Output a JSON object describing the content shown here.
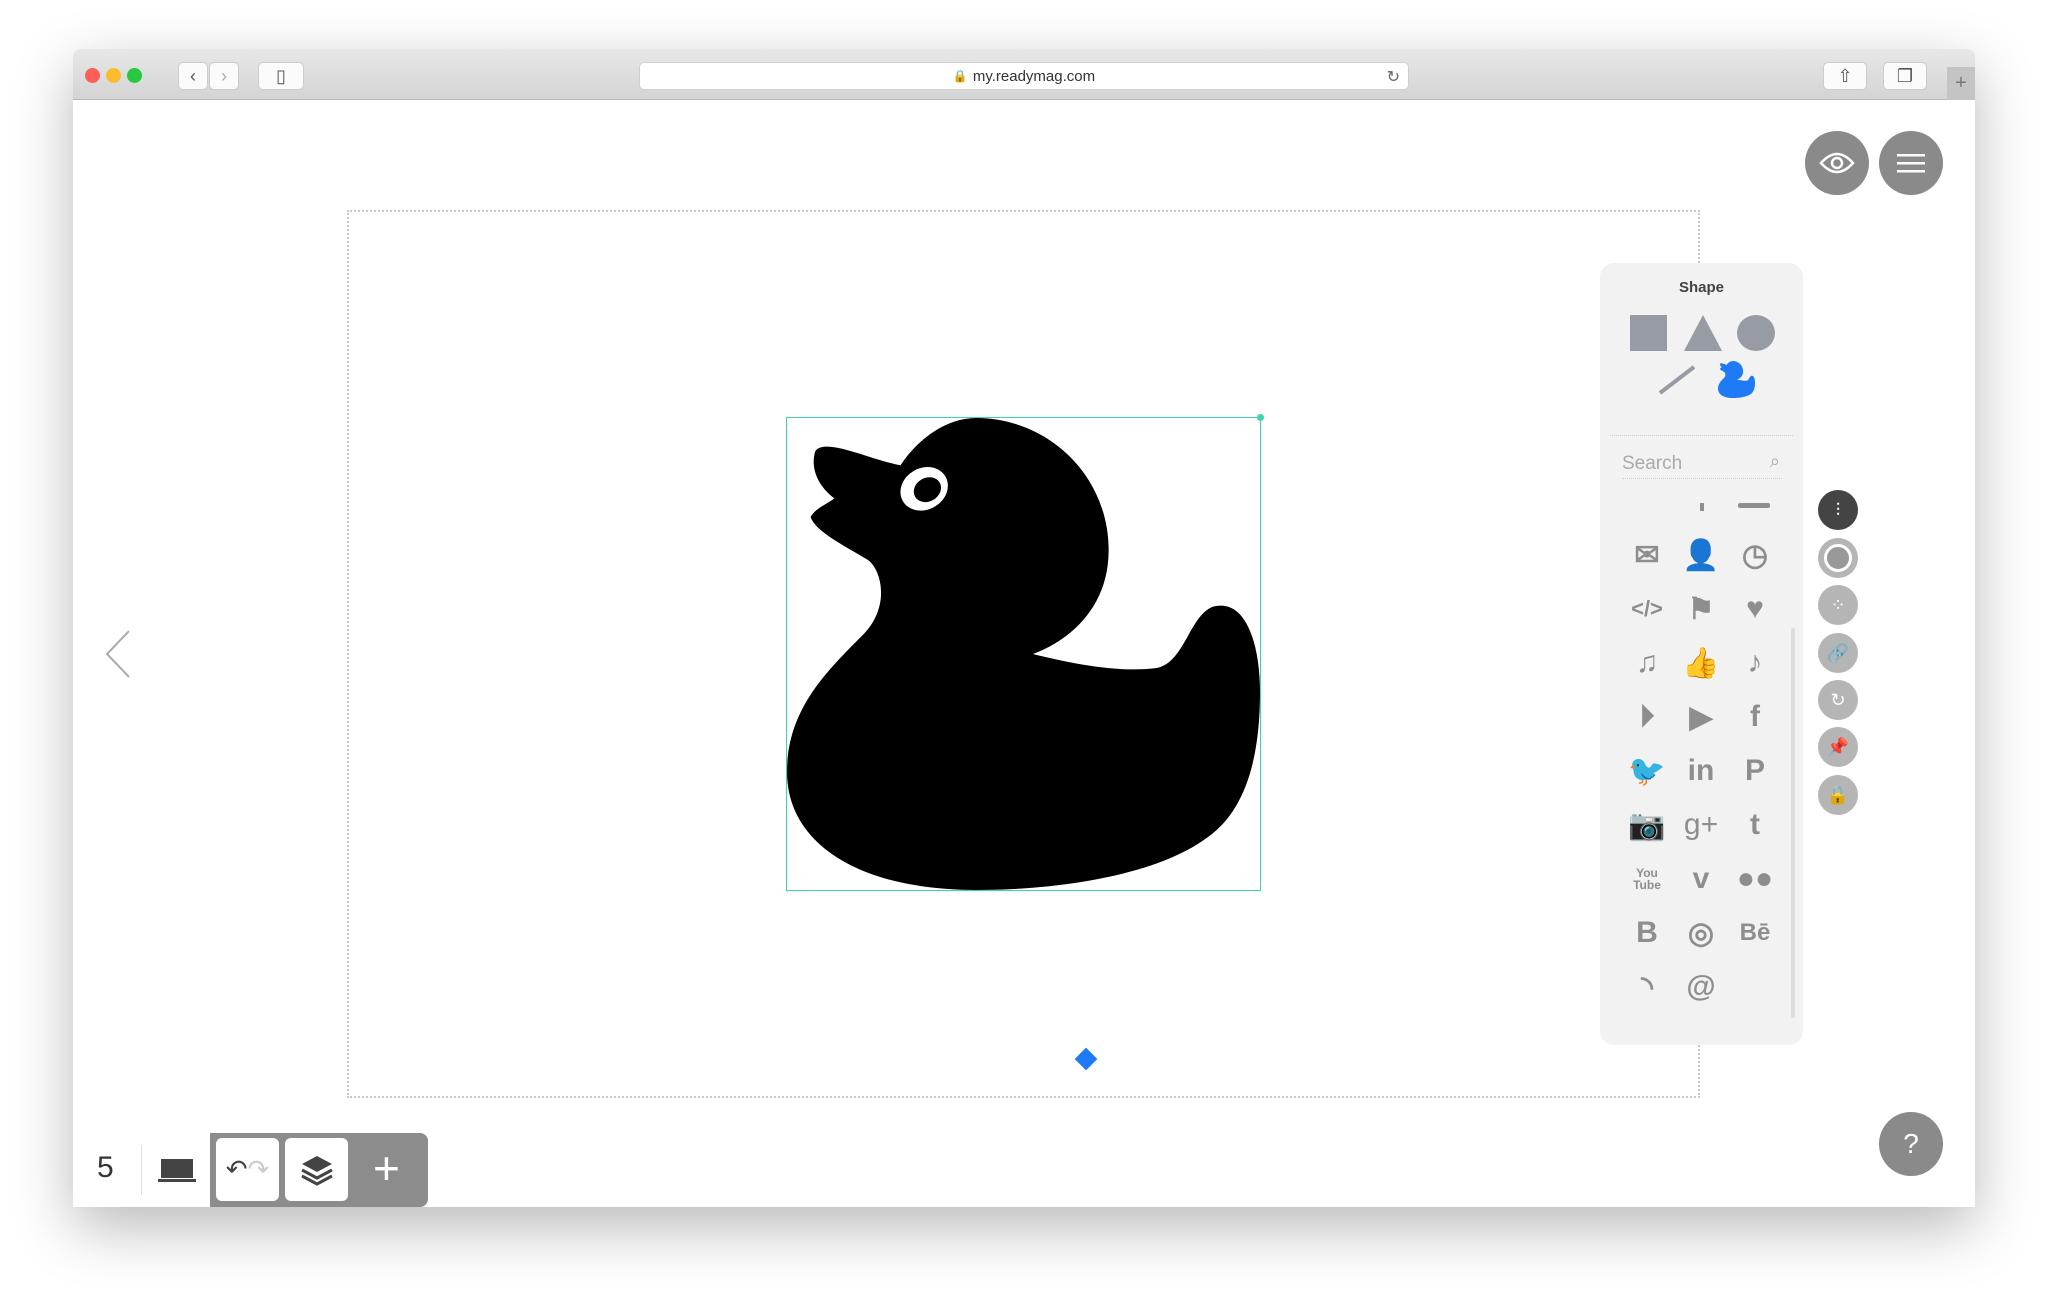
{
  "browser": {
    "url": "my.readymag.com"
  },
  "panel": {
    "title": "Shape",
    "search_placeholder": "Search",
    "icons": [
      "mail-icon",
      "user-icon",
      "clock-icon",
      "code-icon",
      "flag-icon",
      "heart-icon",
      "music-notes-icon",
      "thumbs-up-icon",
      "music-note-icon",
      "play-icon",
      "youtube-icon",
      "facebook-icon",
      "twitter-icon",
      "linkedin-icon",
      "pinterest-icon",
      "instagram-icon",
      "google-plus-icon",
      "tumblr-icon",
      "youtube-text-icon",
      "vimeo-icon",
      "flickr-icon",
      "blogger-icon",
      "dribbble-icon",
      "behance-icon",
      "rss-icon",
      "at-icon"
    ]
  },
  "bottom": {
    "page_number": "5"
  },
  "colors": {
    "accent": "#1e7bf5",
    "selection": "#3fd1b0"
  },
  "help": "?"
}
